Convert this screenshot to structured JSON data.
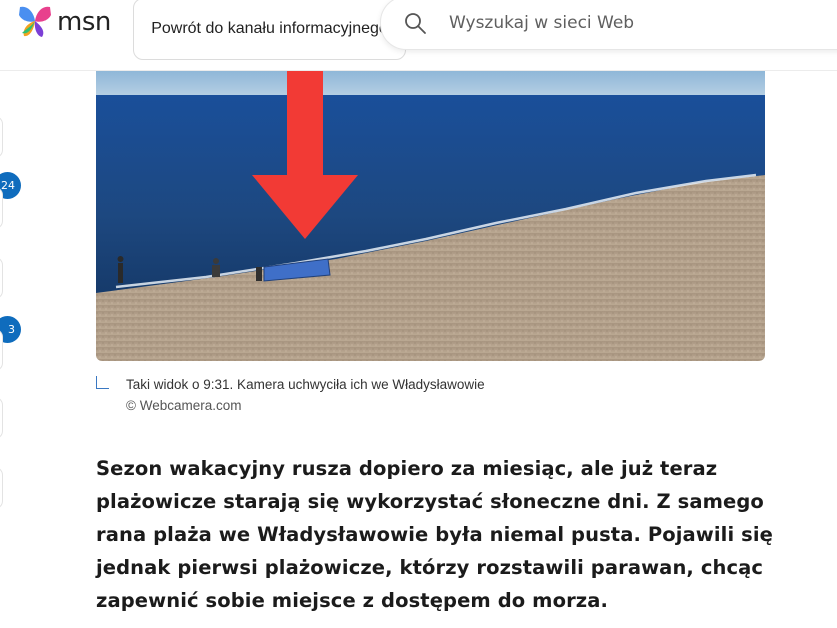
{
  "header": {
    "logo_text": "msn",
    "back_button_label": "Powrót do kanału informacyjnego",
    "search_placeholder": "Wyszukaj w sieci Web"
  },
  "rail": {
    "badges": [
      "24",
      "3"
    ]
  },
  "figure": {
    "caption": "Taki widok o 9:31. Kamera uchwyciła ich we Władysławowie",
    "credit": "© Webcamera.com"
  },
  "article": {
    "paragraph": "Sezon wakacyjny rusza dopiero za miesiąc, ale już teraz plażowicze starają się wykorzystać słoneczne dni. Z samego rana plaża we Władysławowie była niemal pusta. Pojawili się jednak pierwsi plażowicze, którzy rozstawili parawan, chcąc zapewnić sobie miejsce z dostępem do morza."
  },
  "colors": {
    "accent": "#0f6cbd",
    "arrow": "#f23a35",
    "sea": "#1c4a8a",
    "sand": "#b39f87"
  }
}
